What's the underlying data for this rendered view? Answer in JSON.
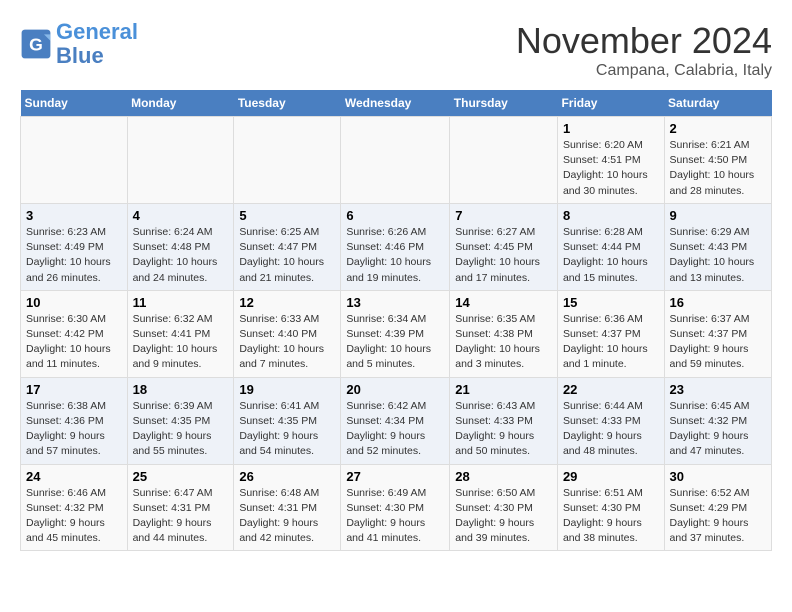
{
  "header": {
    "logo_line1": "General",
    "logo_line2": "Blue",
    "month": "November 2024",
    "location": "Campana, Calabria, Italy"
  },
  "weekdays": [
    "Sunday",
    "Monday",
    "Tuesday",
    "Wednesday",
    "Thursday",
    "Friday",
    "Saturday"
  ],
  "weeks": [
    [
      {
        "day": "",
        "info": ""
      },
      {
        "day": "",
        "info": ""
      },
      {
        "day": "",
        "info": ""
      },
      {
        "day": "",
        "info": ""
      },
      {
        "day": "",
        "info": ""
      },
      {
        "day": "1",
        "info": "Sunrise: 6:20 AM\nSunset: 4:51 PM\nDaylight: 10 hours\nand 30 minutes."
      },
      {
        "day": "2",
        "info": "Sunrise: 6:21 AM\nSunset: 4:50 PM\nDaylight: 10 hours\nand 28 minutes."
      }
    ],
    [
      {
        "day": "3",
        "info": "Sunrise: 6:23 AM\nSunset: 4:49 PM\nDaylight: 10 hours\nand 26 minutes."
      },
      {
        "day": "4",
        "info": "Sunrise: 6:24 AM\nSunset: 4:48 PM\nDaylight: 10 hours\nand 24 minutes."
      },
      {
        "day": "5",
        "info": "Sunrise: 6:25 AM\nSunset: 4:47 PM\nDaylight: 10 hours\nand 21 minutes."
      },
      {
        "day": "6",
        "info": "Sunrise: 6:26 AM\nSunset: 4:46 PM\nDaylight: 10 hours\nand 19 minutes."
      },
      {
        "day": "7",
        "info": "Sunrise: 6:27 AM\nSunset: 4:45 PM\nDaylight: 10 hours\nand 17 minutes."
      },
      {
        "day": "8",
        "info": "Sunrise: 6:28 AM\nSunset: 4:44 PM\nDaylight: 10 hours\nand 15 minutes."
      },
      {
        "day": "9",
        "info": "Sunrise: 6:29 AM\nSunset: 4:43 PM\nDaylight: 10 hours\nand 13 minutes."
      }
    ],
    [
      {
        "day": "10",
        "info": "Sunrise: 6:30 AM\nSunset: 4:42 PM\nDaylight: 10 hours\nand 11 minutes."
      },
      {
        "day": "11",
        "info": "Sunrise: 6:32 AM\nSunset: 4:41 PM\nDaylight: 10 hours\nand 9 minutes."
      },
      {
        "day": "12",
        "info": "Sunrise: 6:33 AM\nSunset: 4:40 PM\nDaylight: 10 hours\nand 7 minutes."
      },
      {
        "day": "13",
        "info": "Sunrise: 6:34 AM\nSunset: 4:39 PM\nDaylight: 10 hours\nand 5 minutes."
      },
      {
        "day": "14",
        "info": "Sunrise: 6:35 AM\nSunset: 4:38 PM\nDaylight: 10 hours\nand 3 minutes."
      },
      {
        "day": "15",
        "info": "Sunrise: 6:36 AM\nSunset: 4:37 PM\nDaylight: 10 hours\nand 1 minute."
      },
      {
        "day": "16",
        "info": "Sunrise: 6:37 AM\nSunset: 4:37 PM\nDaylight: 9 hours\nand 59 minutes."
      }
    ],
    [
      {
        "day": "17",
        "info": "Sunrise: 6:38 AM\nSunset: 4:36 PM\nDaylight: 9 hours\nand 57 minutes."
      },
      {
        "day": "18",
        "info": "Sunrise: 6:39 AM\nSunset: 4:35 PM\nDaylight: 9 hours\nand 55 minutes."
      },
      {
        "day": "19",
        "info": "Sunrise: 6:41 AM\nSunset: 4:35 PM\nDaylight: 9 hours\nand 54 minutes."
      },
      {
        "day": "20",
        "info": "Sunrise: 6:42 AM\nSunset: 4:34 PM\nDaylight: 9 hours\nand 52 minutes."
      },
      {
        "day": "21",
        "info": "Sunrise: 6:43 AM\nSunset: 4:33 PM\nDaylight: 9 hours\nand 50 minutes."
      },
      {
        "day": "22",
        "info": "Sunrise: 6:44 AM\nSunset: 4:33 PM\nDaylight: 9 hours\nand 48 minutes."
      },
      {
        "day": "23",
        "info": "Sunrise: 6:45 AM\nSunset: 4:32 PM\nDaylight: 9 hours\nand 47 minutes."
      }
    ],
    [
      {
        "day": "24",
        "info": "Sunrise: 6:46 AM\nSunset: 4:32 PM\nDaylight: 9 hours\nand 45 minutes."
      },
      {
        "day": "25",
        "info": "Sunrise: 6:47 AM\nSunset: 4:31 PM\nDaylight: 9 hours\nand 44 minutes."
      },
      {
        "day": "26",
        "info": "Sunrise: 6:48 AM\nSunset: 4:31 PM\nDaylight: 9 hours\nand 42 minutes."
      },
      {
        "day": "27",
        "info": "Sunrise: 6:49 AM\nSunset: 4:30 PM\nDaylight: 9 hours\nand 41 minutes."
      },
      {
        "day": "28",
        "info": "Sunrise: 6:50 AM\nSunset: 4:30 PM\nDaylight: 9 hours\nand 39 minutes."
      },
      {
        "day": "29",
        "info": "Sunrise: 6:51 AM\nSunset: 4:30 PM\nDaylight: 9 hours\nand 38 minutes."
      },
      {
        "day": "30",
        "info": "Sunrise: 6:52 AM\nSunset: 4:29 PM\nDaylight: 9 hours\nand 37 minutes."
      }
    ]
  ]
}
